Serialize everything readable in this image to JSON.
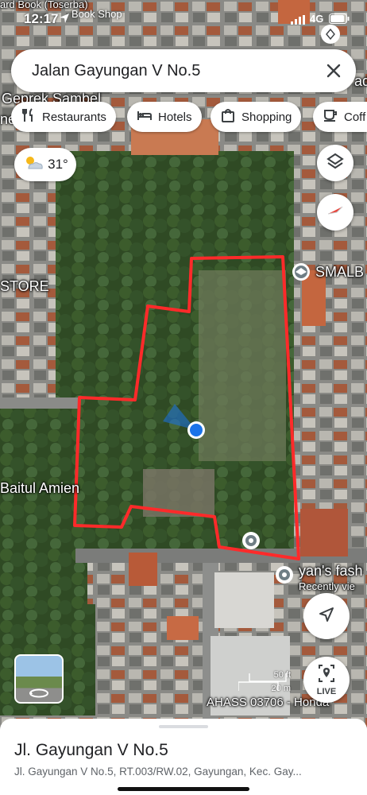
{
  "status_bar": {
    "time": "12:17",
    "back_label": "Book Shop",
    "network": "4G"
  },
  "search": {
    "value": "Jalan Gayungan V No.5"
  },
  "chips": [
    {
      "label": "Restaurants",
      "icon": "restaurant-icon"
    },
    {
      "label": "Hotels",
      "icon": "hotel-icon"
    },
    {
      "label": "Shopping",
      "icon": "shopping-bag-icon"
    },
    {
      "label": "Coff",
      "icon": "coffee-icon"
    }
  ],
  "weather": {
    "temp": "31°",
    "icon": "partly-cloudy-icon"
  },
  "map_labels": {
    "top_left": "ard Book (Toserba)",
    "geprek": "Geprek Sambel",
    "ne": "ne",
    "store": "STORE",
    "smalb": "SMALB",
    "baitul": "Baitul Amien",
    "yans": "yan's fash",
    "recently": "Recently vie",
    "ahass": "AHASS 03706 - Honda",
    "right_edge": "adi"
  },
  "scale": {
    "ft": "50 ft",
    "m": "20 m"
  },
  "live_label": "LIVE",
  "bottom_sheet": {
    "title": "Jl. Gayungan V No.5",
    "address": "Jl. Gayungan V No.5, RT.003/RW.02, Gayungan, Kec. Gay..."
  },
  "colors": {
    "boundary": "#ff2a2a",
    "location_dot": "#1a73e8",
    "accent": "#1a73e8"
  }
}
